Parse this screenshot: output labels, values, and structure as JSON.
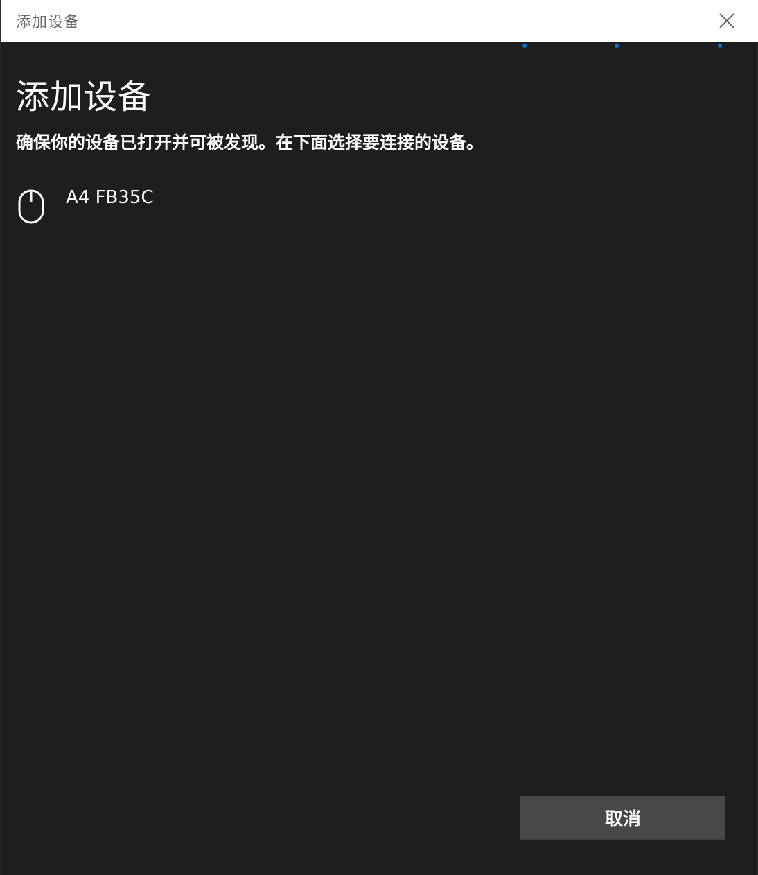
{
  "window": {
    "title": "添加设备"
  },
  "progress": {
    "dot_color": "#0078d7"
  },
  "main": {
    "heading": "添加设备",
    "instruction": "确保你的设备已打开并可被发现。在下面选择要连接的设备。"
  },
  "devices": [
    {
      "name": "A4 FB35C",
      "icon": "mouse-icon"
    }
  ],
  "footer": {
    "cancel_label": "取消"
  },
  "colors": {
    "background": "#1e1e1e",
    "titlebar": "#ffffff",
    "button": "#484848",
    "accent": "#0078d7"
  }
}
